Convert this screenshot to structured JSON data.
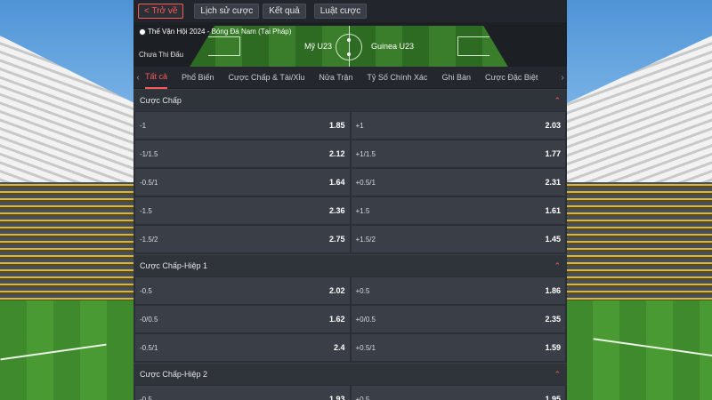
{
  "topbar": {
    "back": "< Trở về",
    "history": "Lịch sử cược",
    "results": "Kết quả",
    "rules": "Luật cược"
  },
  "match": {
    "league": "Thế Vận Hội 2024 - Bóng Đá Nam (Tại Pháp)",
    "status": "Chưa Thi Đấu",
    "home": "Mỹ U23",
    "away": "Guinea U23"
  },
  "tabs": [
    "Tất cả",
    "Phổ Biến",
    "Cược Chấp & Tài/Xỉu",
    "Nửa Trận",
    "Tỷ Số Chính Xác",
    "Ghi Bàn",
    "Cược Đặc Biệt"
  ],
  "tab_arrows": {
    "left": "‹",
    "right": "›"
  },
  "chevron": "⌃",
  "sections": [
    {
      "title": "Cược Chấp",
      "rows": [
        [
          {
            "label": "-1",
            "odd": "1.85"
          },
          {
            "label": "+1",
            "odd": "2.03"
          }
        ],
        [
          {
            "label": "-1/1.5",
            "odd": "2.12"
          },
          {
            "label": "+1/1.5",
            "odd": "1.77"
          }
        ],
        [
          {
            "label": "-0.5/1",
            "odd": "1.64"
          },
          {
            "label": "+0.5/1",
            "odd": "2.31"
          }
        ],
        [
          {
            "label": "-1.5",
            "odd": "2.36"
          },
          {
            "label": "+1.5",
            "odd": "1.61"
          }
        ],
        [
          {
            "label": "-1.5/2",
            "odd": "2.75"
          },
          {
            "label": "+1.5/2",
            "odd": "1.45"
          }
        ]
      ]
    },
    {
      "title": "Cược Chấp-Hiệp 1",
      "rows": [
        [
          {
            "label": "-0.5",
            "odd": "2.02"
          },
          {
            "label": "+0.5",
            "odd": "1.86"
          }
        ],
        [
          {
            "label": "-0/0.5",
            "odd": "1.62"
          },
          {
            "label": "+0/0.5",
            "odd": "2.35"
          }
        ],
        [
          {
            "label": "-0.5/1",
            "odd": "2.4"
          },
          {
            "label": "+0.5/1",
            "odd": "1.59"
          }
        ]
      ]
    },
    {
      "title": "Cược Chấp-Hiệp 2",
      "rows": [
        [
          {
            "label": "-0.5",
            "odd": "1.93"
          },
          {
            "label": "+0.5",
            "odd": "1.95"
          }
        ]
      ]
    }
  ]
}
